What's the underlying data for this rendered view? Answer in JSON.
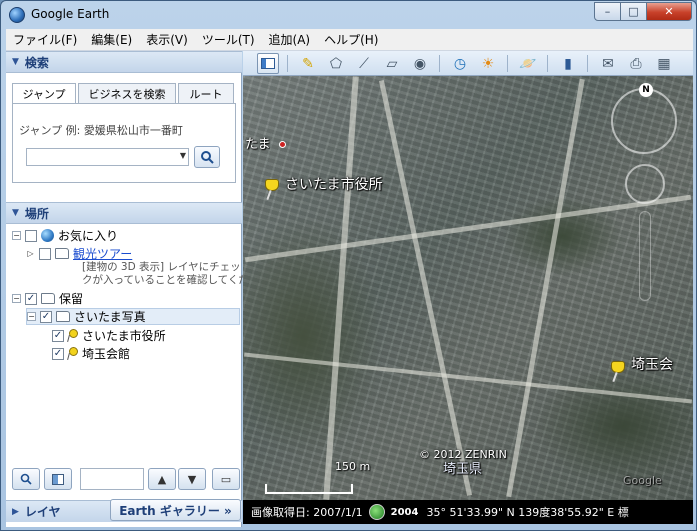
{
  "window": {
    "title": "Google Earth",
    "buttons": {
      "min": "–",
      "max": "□",
      "close": "✕"
    }
  },
  "menu": [
    "ファイル(F)",
    "編集(E)",
    "表示(V)",
    "ツール(T)",
    "追加(A)",
    "ヘルプ(H)"
  ],
  "search": {
    "header": "検索",
    "tabs": [
      "ジャンプ",
      "ビジネスを検索",
      "ルート"
    ],
    "jump_label": "ジャンプ 例: 愛媛県松山市一番町",
    "input_value": ""
  },
  "places": {
    "header": "場所",
    "items": {
      "favorites": "お気に入り",
      "tour": "観光ツアー",
      "tour_desc_1": "[建物の 3D 表示] レイヤにチェッ",
      "tour_desc_2": "クが入っていることを確認してくだ",
      "temp": "保留",
      "photos": "さいたま写真",
      "cityhall": "さいたま市役所",
      "kaikan": "埼玉会館"
    }
  },
  "layers": {
    "header": "レイヤ",
    "gallery": "Earth ギャラリー »"
  },
  "map": {
    "labels": {
      "cityhall": "さいたま市役所",
      "tama": "たま",
      "kaikan": "埼玉会",
      "pref": "埼玉県",
      "copyright": "© 2012 ZENRIN",
      "scale": "150 m",
      "north": "N",
      "google": "Google"
    }
  },
  "status": {
    "image_date": "画像取得日: 2007/1/1",
    "year": "2004",
    "coords": "35° 51'33.99\" N 139度38'55.92\" E 標",
    "elev": ""
  }
}
